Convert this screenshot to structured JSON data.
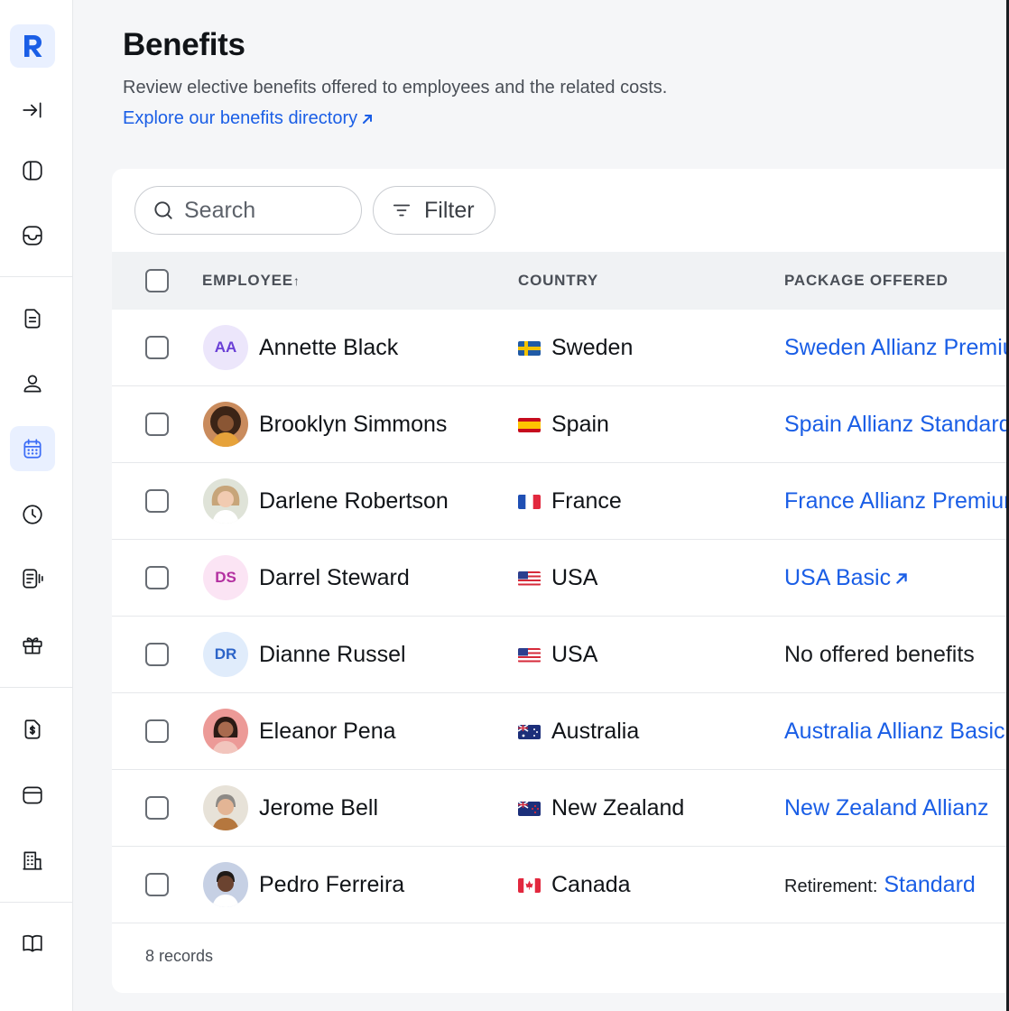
{
  "page": {
    "title": "Benefits",
    "description": "Review elective benefits offered to employees and the related costs.",
    "directory_link": "Explore our benefits directory"
  },
  "toolbar": {
    "search_placeholder": "Search",
    "filter_label": "Filter"
  },
  "table": {
    "columns": [
      "EMPLOYEE",
      "COUNTRY",
      "PACKAGE OFFERED"
    ],
    "rows": [
      {
        "name": "Annette Black",
        "initials": "AA",
        "country": "Sweden",
        "package": "Sweden Allianz Premium"
      },
      {
        "name": "Brooklyn Simmons",
        "initials": "",
        "country": "Spain",
        "package": "Spain Allianz Standard"
      },
      {
        "name": "Darlene Robertson",
        "initials": "",
        "country": "France",
        "package": "France Allianz Premium"
      },
      {
        "name": "Darrel Steward",
        "initials": "DS",
        "country": "USA",
        "package": "USA Basic"
      },
      {
        "name": "Dianne Russel",
        "initials": "DR",
        "country": "USA",
        "package": "No offered benefits"
      },
      {
        "name": "Eleanor Pena",
        "initials": "",
        "country": "Australia",
        "package": "Australia Allianz Basic"
      },
      {
        "name": "Jerome Bell",
        "initials": "",
        "country": "New Zealand",
        "package": "New Zealand Allianz"
      },
      {
        "name": "Pedro Ferreira",
        "initials": "",
        "country": "Canada",
        "package_prefix": "Retirement:",
        "package": "Standard"
      }
    ],
    "footer": "8 records"
  },
  "colors": {
    "accent": "#1a5ee6",
    "active_nav_bg": "#e9f0ff"
  }
}
